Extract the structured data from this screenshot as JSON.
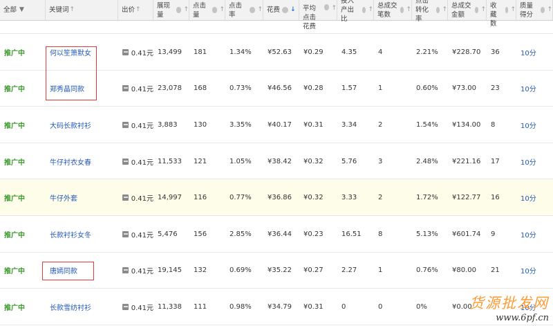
{
  "headers": [
    {
      "key": "status",
      "label": "全部",
      "type": "dropdown"
    },
    {
      "key": "keyword",
      "label": "关键词",
      "type": "sort"
    },
    {
      "key": "bid",
      "label": "出价",
      "type": "sort"
    },
    {
      "key": "impressions",
      "label": "展现量",
      "type": "help-sort"
    },
    {
      "key": "clicks",
      "label": "点击量",
      "type": "help-sort"
    },
    {
      "key": "ctr",
      "label": "点击率",
      "type": "help-sort"
    },
    {
      "key": "spend",
      "label": "花费",
      "type": "help-sort-active"
    },
    {
      "key": "cpc",
      "label": "平均点击花费",
      "type": "help-sort-wrap"
    },
    {
      "key": "roi",
      "label": "投入产出比",
      "type": "help-sort"
    },
    {
      "key": "orders",
      "label": "总成交笔数",
      "type": "help-sort"
    },
    {
      "key": "cvr",
      "label": "点击转化率",
      "type": "help-sort"
    },
    {
      "key": "revenue",
      "label": "总成交金额",
      "type": "help-sort"
    },
    {
      "key": "favorites",
      "label": "总收藏数",
      "type": "help-sort"
    },
    {
      "key": "quality",
      "label": "质量得分",
      "type": "help-sort"
    }
  ],
  "rows": [
    {
      "status": "推广中",
      "keyword": "何以笙箫默女",
      "bid": "0.41元",
      "impressions": "13,499",
      "clicks": "181",
      "ctr": "1.34%",
      "spend": "¥52.63",
      "cpc": "¥0.29",
      "roi": "4.35",
      "orders": "4",
      "cvr": "2.21%",
      "revenue": "¥228.70",
      "favorites": "36",
      "quality": "10分"
    },
    {
      "status": "推广中",
      "keyword": "郑秀晶同款",
      "bid": "0.41元",
      "impressions": "23,078",
      "clicks": "168",
      "ctr": "0.73%",
      "spend": "¥46.56",
      "cpc": "¥0.28",
      "roi": "1.57",
      "orders": "1",
      "cvr": "0.60%",
      "revenue": "¥73.00",
      "favorites": "23",
      "quality": "10分"
    },
    {
      "status": "推广中",
      "keyword": "大码长款衬衫",
      "bid": "0.41元",
      "impressions": "3,883",
      "clicks": "130",
      "ctr": "3.35%",
      "spend": "¥40.17",
      "cpc": "¥0.31",
      "roi": "3.34",
      "orders": "2",
      "cvr": "1.54%",
      "revenue": "¥134.00",
      "favorites": "8",
      "quality": "10分"
    },
    {
      "status": "推广中",
      "keyword": "牛仔衬衣女春",
      "bid": "0.41元",
      "impressions": "11,533",
      "clicks": "121",
      "ctr": "1.05%",
      "spend": "¥38.42",
      "cpc": "¥0.32",
      "roi": "5.76",
      "orders": "3",
      "cvr": "2.48%",
      "revenue": "¥221.16",
      "favorites": "17",
      "quality": "10分"
    },
    {
      "status": "推广中",
      "keyword": "牛仔外套",
      "bid": "0.41元",
      "impressions": "14,997",
      "clicks": "116",
      "ctr": "0.77%",
      "spend": "¥36.86",
      "cpc": "¥0.32",
      "roi": "3.33",
      "orders": "2",
      "cvr": "1.72%",
      "revenue": "¥122.77",
      "favorites": "16",
      "quality": "10分"
    },
    {
      "status": "推广中",
      "keyword": "长款衬衫女冬",
      "bid": "0.41元",
      "impressions": "5,476",
      "clicks": "156",
      "ctr": "2.85%",
      "spend": "¥36.44",
      "cpc": "¥0.23",
      "roi": "16.51",
      "orders": "8",
      "cvr": "5.13%",
      "revenue": "¥601.74",
      "favorites": "9",
      "quality": "10分"
    },
    {
      "status": "推广中",
      "keyword": "唐嫣同款",
      "bid": "0.41元",
      "impressions": "19,145",
      "clicks": "132",
      "ctr": "0.69%",
      "spend": "¥35.22",
      "cpc": "¥0.27",
      "roi": "2.27",
      "orders": "1",
      "cvr": "0.76%",
      "revenue": "¥80.00",
      "favorites": "21",
      "quality": "10分"
    },
    {
      "status": "推广中",
      "keyword": "长款雪纺衬衫",
      "bid": "0.41元",
      "impressions": "11,338",
      "clicks": "111",
      "ctr": "0.98%",
      "spend": "¥34.79",
      "cpc": "¥0.31",
      "roi": "0",
      "orders": "0",
      "cvr": "0%",
      "revenue": "¥0.00",
      "favorites": "",
      "quality": "10分"
    }
  ],
  "highlighted_row": 4,
  "watermark": {
    "text": "货源批发网",
    "url": "www.6pf.cn"
  },
  "colors": {
    "status": "#3a9a2a",
    "link": "#2358b8",
    "highlight": "#fdfdea",
    "annotation": "#e53935",
    "watermark": "#ff9b36"
  }
}
